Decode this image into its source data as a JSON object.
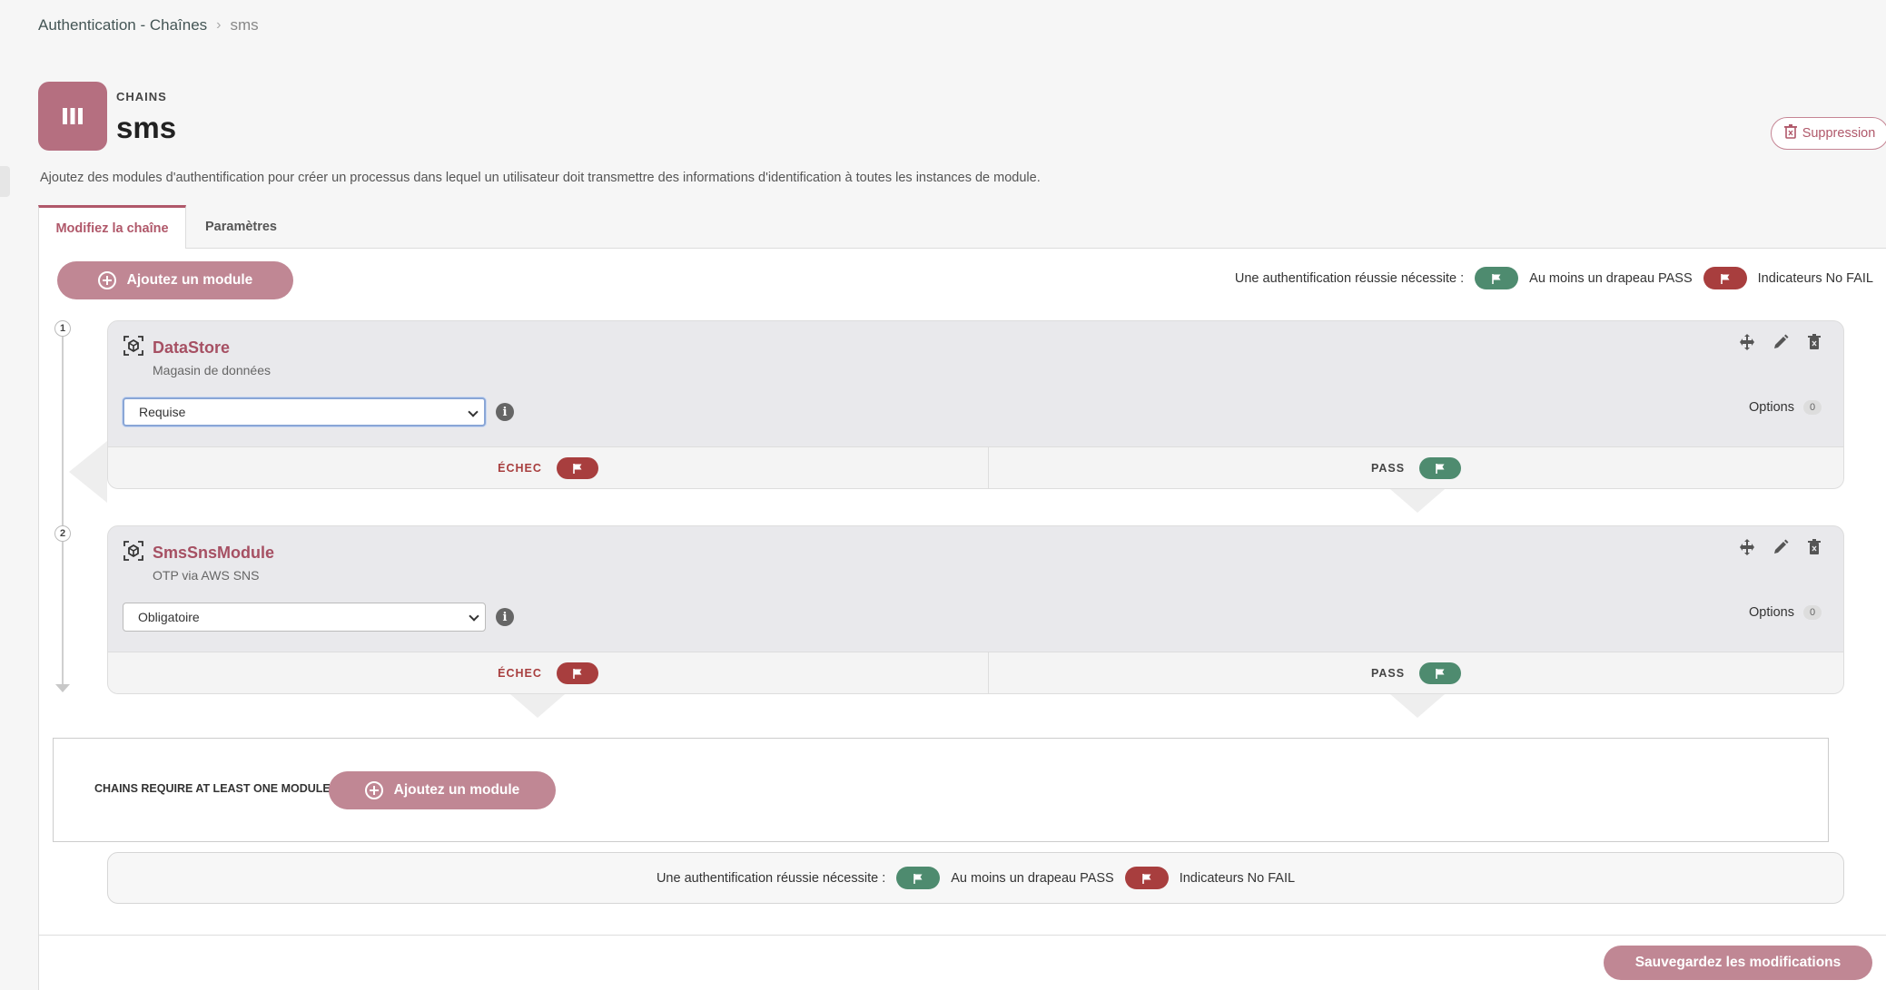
{
  "breadcrumb": {
    "parent": "Authentication - Chaînes",
    "separator": "›",
    "current": "sms"
  },
  "header": {
    "kicker": "CHAINS",
    "title": "sms",
    "description": "Ajoutez des modules d'authentification pour créer un processus dans lequel un utilisateur doit transmettre des informations d'identification à toutes les instances de module.",
    "delete_label": "Suppression"
  },
  "tabs": [
    {
      "label": "Modifiez la chaîne",
      "active": true
    },
    {
      "label": "Paramètres",
      "active": false
    }
  ],
  "add_module_label": "Ajoutez un module",
  "legend": {
    "requires": "Une authentification réussie nécessite :",
    "pass_text": "Au moins un drapeau PASS",
    "fail_text": "Indicateurs No FAIL"
  },
  "modules": [
    {
      "index": "1",
      "name": "DataStore",
      "subtitle": "Magasin de données",
      "criteria": "Requise",
      "options_label": "Options",
      "options_count": "0",
      "fail_label": "ÉCHEC",
      "pass_label": "PASS"
    },
    {
      "index": "2",
      "name": "SmsSnsModule",
      "subtitle": "OTP via AWS SNS",
      "criteria": "Obligatoire",
      "options_label": "Options",
      "options_count": "0",
      "fail_label": "ÉCHEC",
      "pass_label": "PASS"
    }
  ],
  "empty_state": {
    "label": "CHAINS REQUIRE AT LEAST ONE MODULE",
    "button": "Ajoutez un module"
  },
  "save_label": "Sauvegardez les modifications",
  "colors": {
    "accent": "#b0586a",
    "button": "#c08794",
    "pass": "#4e8b6f",
    "fail": "#a83e3e"
  }
}
